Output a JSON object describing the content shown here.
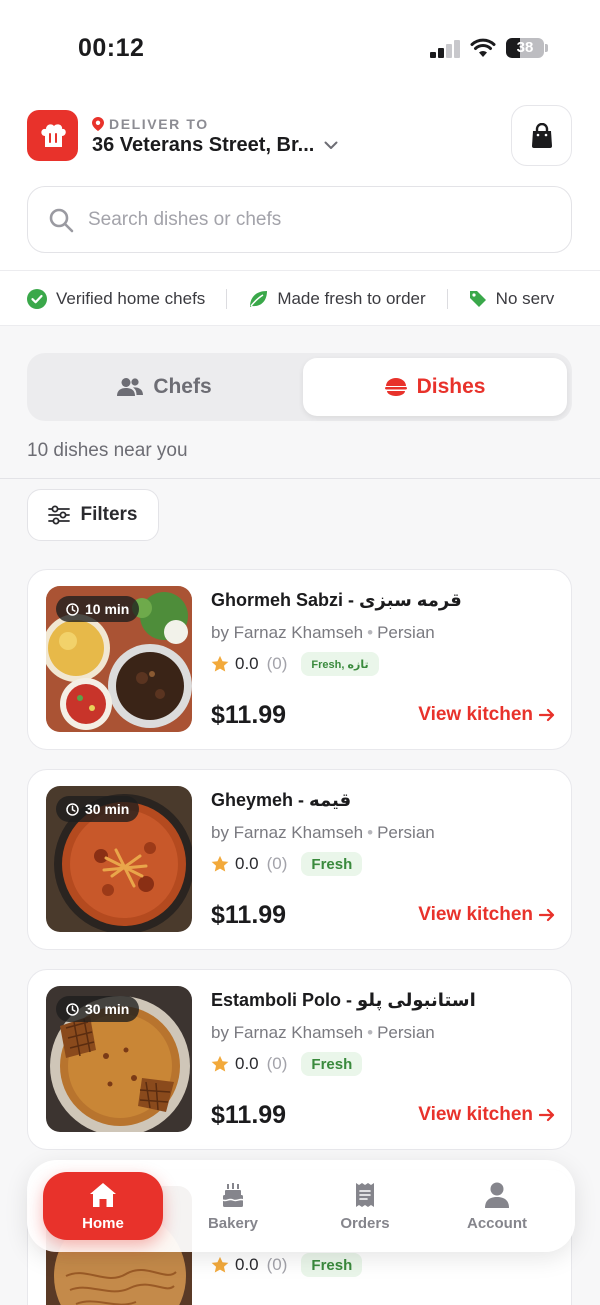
{
  "status_bar": {
    "time": "00:12",
    "battery": "38"
  },
  "header": {
    "deliver_label": "DELIVER TO",
    "address": "36 Veterans Street, Br...",
    "search_placeholder": "Search dishes or chefs"
  },
  "trust_badges": [
    "Verified home chefs",
    "Made fresh to order",
    "No serv"
  ],
  "tabs": {
    "chefs": "Chefs",
    "dishes": "Dishes",
    "active": "dishes"
  },
  "results_count": "10 dishes near you",
  "filters_label": "Filters",
  "dishes": [
    {
      "time": "10 min",
      "name": "Ghormeh Sabzi - قرمه سبزی",
      "chef": "by Farnaz Khamseh",
      "cuisine": "Persian",
      "rating": "0.0",
      "reviews": "(0)",
      "badge": "Fresh, تازه",
      "price": "$11.99",
      "cta": "View kitchen"
    },
    {
      "time": "30 min",
      "name": "Gheymeh - قیمه",
      "chef": "by Farnaz Khamseh",
      "cuisine": "Persian",
      "rating": "0.0",
      "reviews": "(0)",
      "badge": "Fresh",
      "price": "$11.99",
      "cta": "View kitchen"
    },
    {
      "time": "30 min",
      "name": "Estamboli Polo - استانبولی پلو",
      "chef": "by Farnaz Khamseh",
      "cuisine": "Persian",
      "rating": "0.0",
      "reviews": "(0)",
      "badge": "Fresh",
      "price": "$11.99",
      "cta": "View kitchen"
    },
    {
      "rating": "0.0",
      "reviews": "(0)",
      "badge": "Fresh"
    }
  ],
  "bottom_nav": [
    {
      "label": "Home",
      "icon": "home-icon",
      "active": true
    },
    {
      "label": "Bakery",
      "icon": "cake-icon"
    },
    {
      "label": "Orders",
      "icon": "receipt-icon"
    },
    {
      "label": "Account",
      "icon": "person-icon"
    }
  ],
  "colors": {
    "brand": "#e8322b",
    "fresh_badge_bg": "#eaf6ea",
    "fresh_badge_text": "#3a8a3d",
    "star": "#f2a93b"
  }
}
